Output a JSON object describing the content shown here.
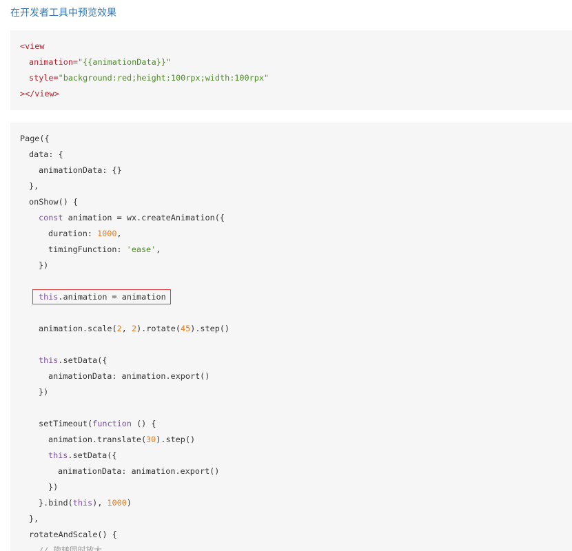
{
  "header": {
    "preview_link": "在开发者工具中预览效果"
  },
  "xml_code": {
    "line1_tag": "<view",
    "line2_attr": "animation=",
    "line2_val": "\"{{animationData}}\"",
    "line3_attr": "style=",
    "line3_val": "\"background:red;height:100rpx;width:100rpx\"",
    "line4_tag": "></view>"
  },
  "js_code": {
    "l_page": "Page({",
    "l_data": "data: {",
    "l_animdata": "animationData: {}",
    "l_data_close": "},",
    "l_onshow": "onShow() {",
    "l_const_kw": "const",
    "l_const_rest": " animation = wx.createAnimation({",
    "l_duration_key": "duration: ",
    "l_duration_val": "1000",
    "l_duration_comma": ",",
    "l_timing_key": "timingFunction: ",
    "l_timing_val": "'ease'",
    "l_timing_comma": ",",
    "l_close_paren": "})",
    "l_this_kw": "this",
    "l_this_rest": ".animation = animation",
    "l_scale_a": "animation.scale(",
    "l_scale_n1": "2",
    "l_scale_sep": ", ",
    "l_scale_n2": "2",
    "l_scale_b": ").rotate(",
    "l_scale_n3": "45",
    "l_scale_c": ").step()",
    "l_setdata_kw": "this",
    "l_setdata_rest": ".setData({",
    "l_export": "animationData: animation.export()",
    "l_close_paren2": "})",
    "l_timeout_a": "setTimeout(",
    "l_timeout_kw": "function",
    "l_timeout_b": " () {",
    "l_translate_a": "animation.translate(",
    "l_translate_n": "30",
    "l_translate_b": ").step()",
    "l_setdata2_kw": "this",
    "l_setdata2_rest": ".setData({",
    "l_export2": "animationData: animation.export()",
    "l_close_paren3": "})",
    "l_bind_a": "}.bind(",
    "l_bind_kw": "this",
    "l_bind_b": "), ",
    "l_bind_n": "1000",
    "l_bind_c": ")",
    "l_onshow_close": "},",
    "l_rotate": "rotateAndScale() {",
    "l_comment": "// 旋转同时放大"
  },
  "colors": {
    "link": "#3778b4",
    "code_bg": "#f6f6f6",
    "tag": "#b0202c",
    "string": "#4b8a25",
    "keyword": "#7b4fa6",
    "number": "#e07b1f",
    "highlight_border": "#d93a3a"
  }
}
